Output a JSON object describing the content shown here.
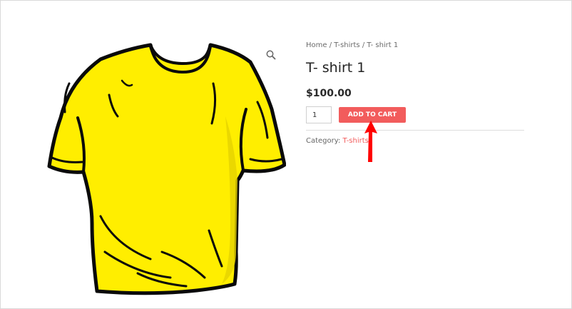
{
  "breadcrumb": {
    "home": "Home",
    "sep1": " / ",
    "category": "T-shirts",
    "sep2": " / ",
    "current": "T- shirt 1"
  },
  "product": {
    "title": "T- shirt 1",
    "price": "$100.00"
  },
  "cart": {
    "quantity": "1",
    "add_label": "ADD TO CART"
  },
  "meta": {
    "category_label": "Category: ",
    "category_value": "T-shirts"
  },
  "icons": {
    "zoom": "magnifier-icon",
    "annotation": "red-arrow-pointer"
  },
  "colors": {
    "accent": "#f25c5c",
    "shirt": "#ffee00",
    "arrow": "#ff0000"
  }
}
